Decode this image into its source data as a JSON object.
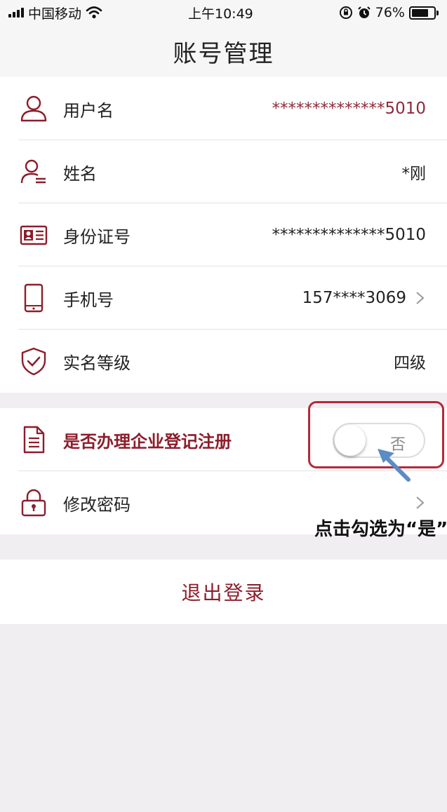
{
  "status_bar": {
    "carrier": "中国移动",
    "time": "上午10:49",
    "battery": "76%",
    "battery_level": 0.76
  },
  "nav": {
    "title": "账号管理"
  },
  "account_rows": [
    {
      "label": "用户名",
      "value": "**************5010",
      "icon": "user-icon"
    },
    {
      "label": "姓名",
      "value": "*刚",
      "icon": "user-card-icon"
    },
    {
      "label": "身份证号",
      "value": "**************5010",
      "icon": "id-card-icon"
    },
    {
      "label": "手机号",
      "value": "157****3069",
      "icon": "phone-icon"
    },
    {
      "label": "实名等级",
      "value": "四级",
      "icon": "shield-check-icon"
    }
  ],
  "settings_rows": [
    {
      "label": "是否办理企业登记注册",
      "toggle_label": "否",
      "toggle_on": false,
      "icon": "document-icon"
    },
    {
      "label": "修改密码",
      "icon": "lock-icon"
    }
  ],
  "annotation": {
    "text": "点击勾选为“是”",
    "color": "#b22a3a"
  },
  "logout": {
    "label": "退出登录"
  },
  "colors": {
    "accent": "#8c1d2b",
    "background": "#f0eef0"
  }
}
